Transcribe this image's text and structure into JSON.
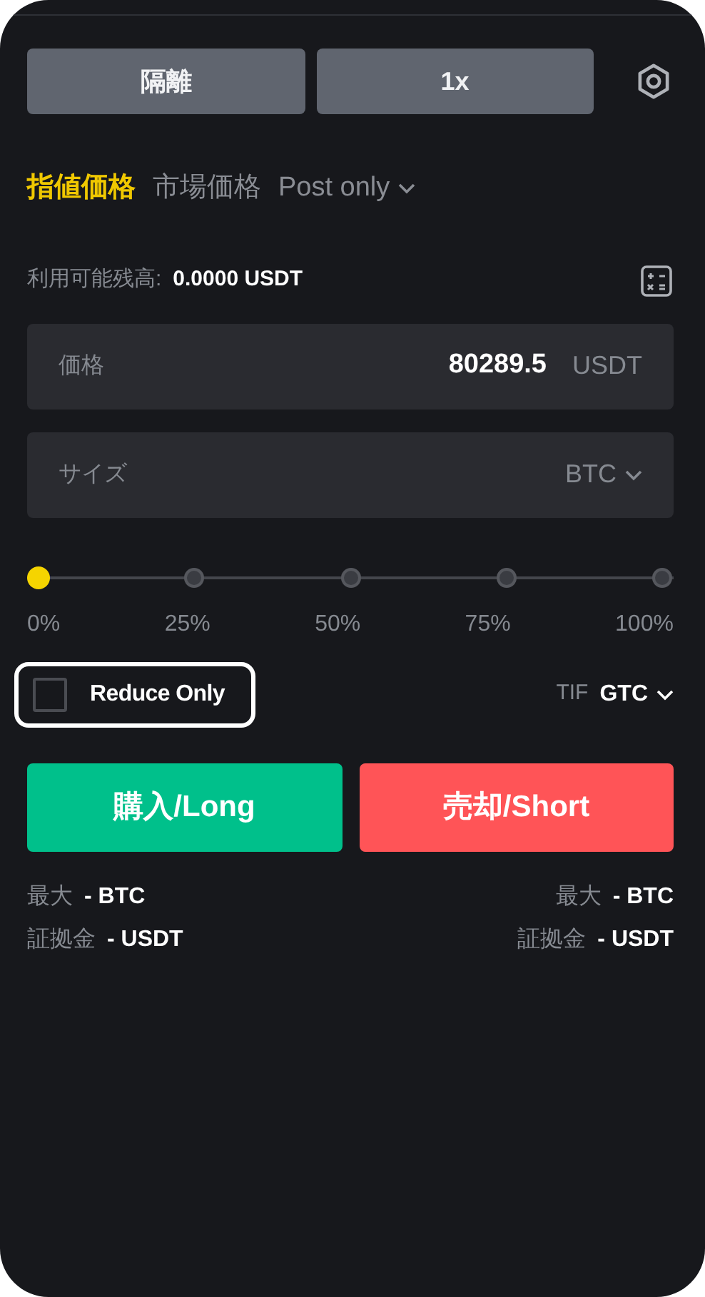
{
  "top_buttons": [
    {
      "label": "隔離"
    },
    {
      "label": "1x"
    }
  ],
  "order_types": [
    {
      "label": "指値価格",
      "selected": true,
      "dropdown": false
    },
    {
      "label": "市場価格",
      "selected": false,
      "dropdown": false
    },
    {
      "label": "Post only",
      "selected": false,
      "dropdown": true
    }
  ],
  "balance": {
    "label": "利用可能残高:",
    "value": "0.0000 USDT"
  },
  "fields": [
    {
      "placeholder": "価格",
      "value": "80289.5",
      "unit": "USDT",
      "dropdown": false
    },
    {
      "placeholder": "サイズ",
      "unit": "BTC",
      "dropdown": true
    }
  ],
  "slider": {
    "level": 0,
    "marks": [
      "0%",
      "25%",
      "50%",
      "75%",
      "100%"
    ]
  },
  "reduce_only": {
    "label": "Reduce Only",
    "checked": false,
    "highlighted": true
  },
  "tif": {
    "label": "TIF",
    "value": "GTC"
  },
  "actions": [
    {
      "label": "購入/Long",
      "kind": "buy"
    },
    {
      "label": "売却/Short",
      "kind": "sell"
    }
  ],
  "limits": [
    [
      {
        "label": "最大",
        "value": "- BTC"
      },
      {
        "label": "証拠金",
        "value": "- USDT"
      }
    ],
    [
      {
        "label": "最大",
        "value": "- BTC"
      },
      {
        "label": "証拠金",
        "value": "- USDT"
      }
    ]
  ]
}
